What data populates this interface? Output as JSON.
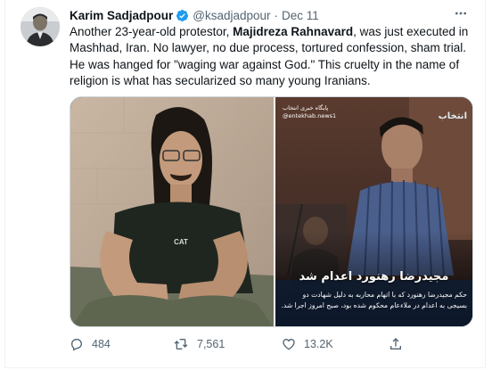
{
  "tweet": {
    "author_name": "Karim Sadjadpour",
    "handle": "@ksadjadpour",
    "separator": "·",
    "date": "Dec 11",
    "text_before": "Another 23-year-old protestor, ",
    "text_bold": "Majidreza Rahnavard",
    "text_after": ", was just executed in Mashhad, Iran. No lawyer, no due process, tortured confession, sham trial. He was hanged for \"waging war against God.\" This cruelty in the name of religion is what has secularized so many young Iranians."
  },
  "media": {
    "left_shirt_logo": "CAT",
    "right_channel_name": "پایگاه خبری انتخاب",
    "right_channel_handle": "@entekhab.news1",
    "right_brand": "انتخاب",
    "right_overlay_title": "مجیدرضا رهنورد اعدام شد",
    "right_overlay_desc": "حکم مجیدرضا رهنورد که با اتهام محاربه به دلیل شهادت دو بسیجی به اعدام در ملاءعام محکوم شده بود، صبح امروز اجرا شد."
  },
  "actions": {
    "reply_count": "484",
    "retweet_count": "7,561",
    "like_count": "13.2K"
  },
  "colors": {
    "text_primary": "#0f1419",
    "text_secondary": "#536471",
    "verified": "#1d9bf0",
    "border": "#cfd9de"
  },
  "icons": [
    "verified-badge-icon",
    "more-icon",
    "reply-icon",
    "retweet-icon",
    "like-icon",
    "share-icon"
  ]
}
